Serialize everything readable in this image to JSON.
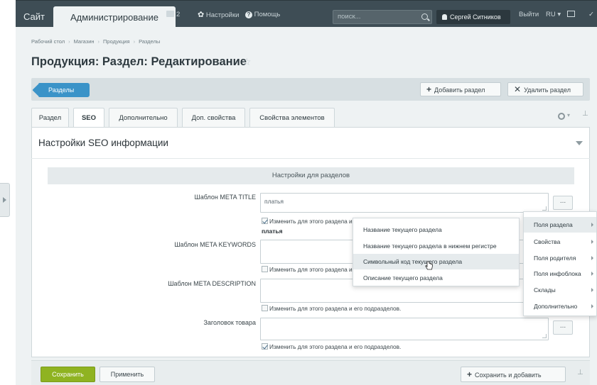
{
  "topbar": {
    "site_tab": "Сайт",
    "admin_tab": "Администрирование",
    "notifications_count": "2",
    "settings_label": "Настройки",
    "help_label": "Помощь",
    "search_placeholder": "поиск...",
    "user_name": "Сергей Ситников",
    "logout_label": "Выйти",
    "lang_label": "RU"
  },
  "breadcrumb": [
    "Рабочий стол",
    "Магазин",
    "Продукция",
    "Разделы"
  ],
  "page_title": "Продукция: Раздел: Редактирование",
  "actionbar": {
    "sections_label": "Разделы",
    "add_section_label": "Добавить раздел",
    "delete_section_label": "Удалить раздел"
  },
  "tabs": [
    {
      "label": "Раздел"
    },
    {
      "label": "SEO"
    },
    {
      "label": "Дополнительно"
    },
    {
      "label": "Доп. свойства"
    },
    {
      "label": "Свойства элементов"
    }
  ],
  "panel": {
    "title": "Настройки SEO информации",
    "group_header": "Настройки для разделов",
    "fields": [
      {
        "label": "Шаблон META TITLE",
        "value": "платья",
        "checkbox_label": "Изменить для этого раздела и его подразделов.",
        "checked": true,
        "preview": "платья"
      },
      {
        "label": "Шаблон META KEYWORDS",
        "value": "",
        "checkbox_label": "Изменить для этого раздела и его подразделов.",
        "checked": false
      },
      {
        "label": "Шаблон META DESCRIPTION",
        "value": "",
        "checkbox_label": "Изменить для этого раздела и его подразделов.",
        "checked": false
      },
      {
        "label": "Заголовок товара",
        "value": "",
        "checkbox_label": "Изменить для этого раздела и его подразделов.",
        "checked": true
      }
    ],
    "dots_label": "..."
  },
  "context_menu_left": [
    "Название текущего раздела",
    "Название текущего раздела в нижнем регистре",
    "Символьный код текущего раздела",
    "Описание текущего раздела"
  ],
  "context_menu_right": [
    "Поля раздела",
    "Свойства",
    "Поля родителя",
    "Поля инфоблока",
    "Склады",
    "Дополнительно"
  ],
  "bottombar": {
    "save_label": "Сохранить",
    "apply_label": "Применить",
    "save_add_label": "Сохранить и добавить"
  }
}
